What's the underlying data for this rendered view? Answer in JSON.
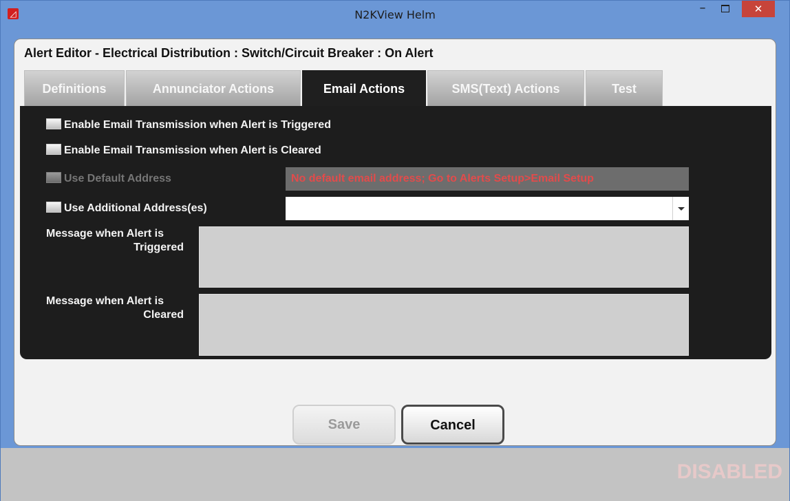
{
  "window": {
    "title": "N2KView Helm",
    "minimize": "–",
    "close": "✕"
  },
  "header": {
    "title": "Alert Editor - Electrical Distribution : Switch/Circuit Breaker : On Alert"
  },
  "tabs": [
    {
      "label": "Definitions"
    },
    {
      "label": "Annunciator Actions"
    },
    {
      "label": "Email Actions"
    },
    {
      "label": "SMS(Text) Actions"
    },
    {
      "label": "Test"
    }
  ],
  "email": {
    "triggered_label": "Enable Email Transmission when Alert is Triggered",
    "cleared_label": "Enable Email Transmission when Alert is Cleared",
    "default_address_label": "Use Default Address",
    "default_address_warning": "No default email address; Go to Alerts Setup>Email Setup",
    "additional_label": "Use Additional Address(es)",
    "additional_value": "",
    "triggered_msg_label_1": "Message when Alert is",
    "triggered_msg_label_2": "Triggered",
    "triggered_msg_value": "",
    "cleared_msg_label_1": "Message when Alert is",
    "cleared_msg_label_2": "Cleared",
    "cleared_msg_value": ""
  },
  "buttons": {
    "save": "Save",
    "cancel": "Cancel"
  },
  "status": {
    "text": "DISABLED"
  }
}
